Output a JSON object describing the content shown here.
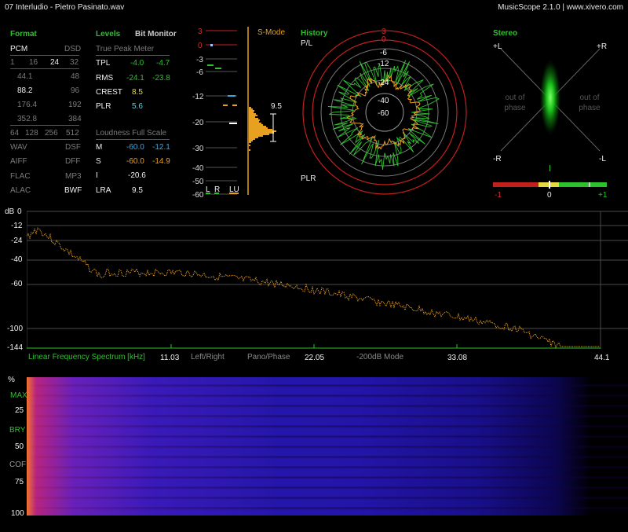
{
  "title": "07 Interludio - Pietro Pasinato.wav",
  "app": "MusicScope 2.1.0 | www.xivero.com",
  "format": {
    "heading": "Format",
    "pcm": "PCM",
    "dsd": "DSD",
    "bits": [
      "1",
      "16",
      "24",
      "32"
    ],
    "rates": [
      [
        "44.1",
        "48"
      ],
      [
        "88.2",
        "96"
      ],
      [
        "176.4",
        "192"
      ],
      [
        "352.8",
        "384"
      ]
    ],
    "dsd_rates": [
      "64",
      "128",
      "256",
      "512"
    ],
    "files": [
      [
        "WAV",
        "DSF"
      ],
      [
        "AIFF",
        "DFF"
      ],
      [
        "FLAC",
        "MP3"
      ],
      [
        "ALAC",
        "BWF"
      ]
    ]
  },
  "levels": {
    "heading": "Levels",
    "bit_monitor": "Bit Monitor",
    "true_peak_meter": "True Peak Meter",
    "rows": [
      {
        "label": "TPL",
        "a": "-4.0",
        "b": "-4.7"
      },
      {
        "label": "RMS",
        "a": "-24.1",
        "b": "-23.8"
      },
      {
        "label": "CREST",
        "a": "8.5",
        "b": ""
      },
      {
        "label": "PLR",
        "a": "5.6",
        "b": ""
      }
    ],
    "loudness_heading": "Loudness Full Scale",
    "loudness": [
      {
        "label": "M",
        "a": "-60.0",
        "b": "-12.1"
      },
      {
        "label": "S",
        "a": "-60.0",
        "b": "-14.9"
      },
      {
        "label": "I",
        "a": "-20.6",
        "b": ""
      },
      {
        "label": "LRA",
        "a": "9.5",
        "b": ""
      }
    ]
  },
  "meter": {
    "smode": "S-Mode",
    "scale": [
      "3",
      "0",
      "-3",
      "-6",
      "-12",
      "-20",
      "-30",
      "-40",
      "-50",
      "-60"
    ],
    "lra_value": "9.5",
    "channels": [
      "L",
      "R",
      "LU"
    ]
  },
  "history": {
    "heading": "History",
    "pl": "P/L",
    "plr": "PLR",
    "rings": [
      "3",
      "0",
      "-6",
      "-12",
      "-24",
      "-40",
      "-60"
    ]
  },
  "stereo": {
    "heading": "Stereo",
    "corners": [
      "+L",
      "+R",
      "-R",
      "-L"
    ],
    "oop_left": "out of phase",
    "oop_right": "out of phase",
    "corr_labels": [
      "-1",
      "0",
      "+1"
    ]
  },
  "spectrum": {
    "db_label": "dB",
    "y_ticks": [
      "0",
      "-12",
      "-24",
      "-40",
      "-60",
      "-100",
      "-144"
    ],
    "title": "Linear Frequency Spectrum [kHz]",
    "x_ticks": [
      "11.03",
      "22.05",
      "33.08",
      "44.1"
    ],
    "modes": [
      "Left/Right",
      "Pano/Phase",
      "-200dB Mode"
    ]
  },
  "spectrogram": {
    "y_labels": [
      "%",
      "MAX",
      "25",
      "BRY",
      "50",
      "COF",
      "75",
      "100"
    ]
  },
  "colors": {
    "green": "#2fc02f",
    "orange": "#e8a020",
    "red": "#c0201e",
    "blue": "#3aa8e0",
    "yellow": "#e8d840"
  }
}
